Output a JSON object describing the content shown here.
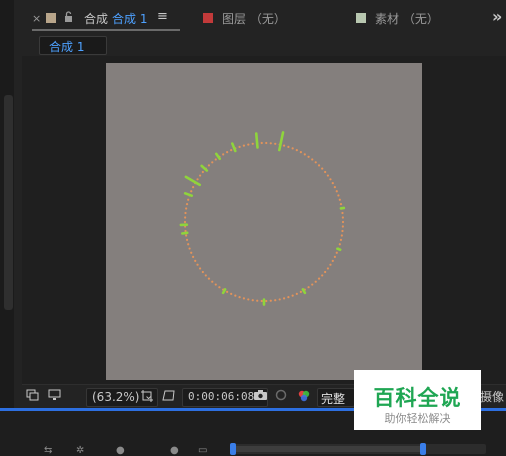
{
  "tabs": {
    "close_glyph": "×",
    "comp_prefix": "合成",
    "comp_name": "合成 1",
    "menu_glyph": "≡",
    "layer_panel": "图层 （无）",
    "footage_panel": "素材 （无）",
    "overflow_glyph": "»",
    "comp_swatch_color": "#b8a58a",
    "layer_swatch_color": "#c23a3a",
    "footage_swatch_color": "#b8c7b0"
  },
  "subtab": {
    "label": "合成 1"
  },
  "canvas": {
    "background": "#847f7d"
  },
  "footer": {
    "zoom": "(63.2%)",
    "timecode": "0:00:06:08",
    "quality": "完整",
    "camera": "摄像"
  },
  "watermark": {
    "title": "百科全说",
    "subtitle": "助你轻松解决"
  }
}
